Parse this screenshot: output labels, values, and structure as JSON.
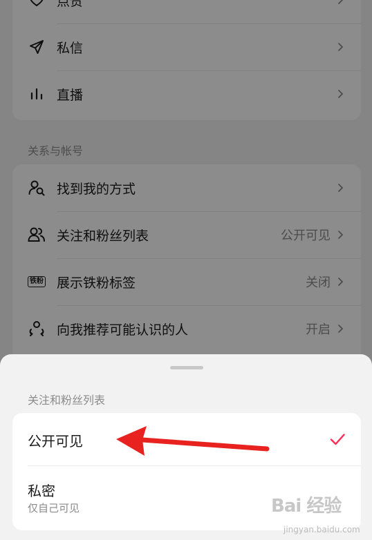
{
  "notifications_card": {
    "items": [
      {
        "label": "点赞",
        "icon": "heart-icon"
      },
      {
        "label": "私信",
        "icon": "send-icon"
      },
      {
        "label": "直播",
        "icon": "live-bars-icon"
      }
    ]
  },
  "relations_section": {
    "title": "关系与帐号",
    "items": [
      {
        "label": "找到我的方式",
        "value": "",
        "icon": "find-user-icon"
      },
      {
        "label": "关注和粉丝列表",
        "value": "公开可见",
        "icon": "users-icon"
      },
      {
        "label": "展示铁粉标签",
        "value": "关闭",
        "icon": "fan-badge-icon",
        "badge_text": "铁粉"
      },
      {
        "label": "向我推荐可能认识的人",
        "value": "开启",
        "icon": "recommend-icon"
      }
    ]
  },
  "sheet": {
    "title": "关注和粉丝列表",
    "options": [
      {
        "label": "公开可见",
        "sublabel": "",
        "selected": true
      },
      {
        "label": "私密",
        "sublabel": "仅自己可见",
        "selected": false
      }
    ]
  },
  "colors": {
    "accent": "#fe2c55",
    "annotation_arrow": "#e8231f",
    "background": "#f2f2f2",
    "overlay": "rgba(0,0,0,0.45)"
  },
  "watermark": {
    "text": "Bai 经验",
    "sub": "jingyan.baidu.com"
  }
}
